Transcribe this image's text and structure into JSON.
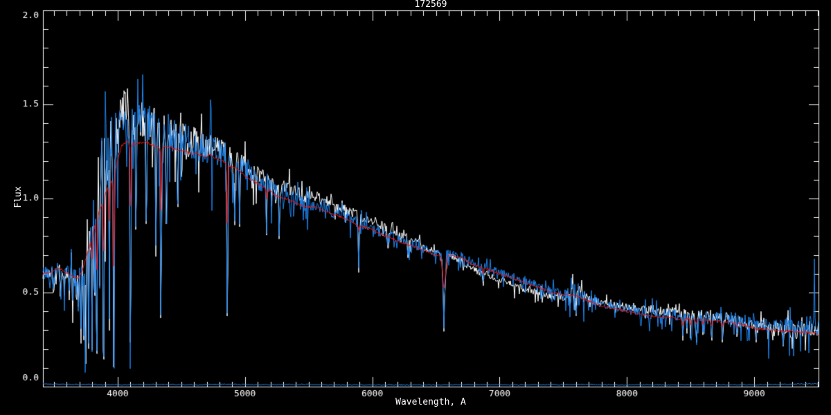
{
  "chart_data": {
    "type": "line",
    "title": "172569",
    "xlabel": "Wavelength, A",
    "ylabel": "Flux",
    "xlim": [
      3413,
      9505
    ],
    "ylim": [
      0,
      2.0
    ],
    "grid": false,
    "legend": null,
    "background_color": "#000000",
    "axis_color": "#ffffff",
    "x_major_ticks": [
      4000,
      5000,
      6000,
      7000,
      8000,
      9000
    ],
    "x_tick_labels": [
      "4000",
      "5000",
      "6000",
      "7000",
      "8000",
      "9000"
    ],
    "x_minor_step": 100,
    "y_major_ticks": [
      0.0,
      0.5,
      1.0,
      1.5,
      2.0
    ],
    "y_tick_labels": [
      "0.0",
      "0.5",
      "1.0",
      "1.5",
      "2.0"
    ],
    "y_minor_step": 0.1,
    "continuum": [
      [
        3413,
        0.6
      ],
      [
        3460,
        0.607
      ],
      [
        3500,
        0.615
      ],
      [
        3525,
        0.635
      ],
      [
        3555,
        0.625
      ],
      [
        3600,
        0.6
      ],
      [
        3650,
        0.585
      ],
      [
        3690,
        0.575
      ],
      [
        3730,
        0.63
      ],
      [
        3770,
        0.73
      ],
      [
        3810,
        0.83
      ],
      [
        3850,
        0.92
      ],
      [
        3890,
        1.0
      ],
      [
        3925,
        1.06
      ],
      [
        3960,
        1.1
      ],
      [
        4000,
        1.2
      ],
      [
        4030,
        1.28
      ],
      [
        4070,
        1.3
      ],
      [
        4120,
        1.29
      ],
      [
        4170,
        1.295
      ],
      [
        4220,
        1.3
      ],
      [
        4270,
        1.285
      ],
      [
        4320,
        1.27
      ],
      [
        4370,
        1.275
      ],
      [
        4420,
        1.27
      ],
      [
        4470,
        1.26
      ],
      [
        4520,
        1.25
      ],
      [
        4570,
        1.24
      ],
      [
        4620,
        1.24
      ],
      [
        4670,
        1.225
      ],
      [
        4720,
        1.23
      ],
      [
        4770,
        1.215
      ],
      [
        4820,
        1.2
      ],
      [
        4880,
        1.17
      ],
      [
        4950,
        1.155
      ],
      [
        5000,
        1.12
      ],
      [
        5060,
        1.095
      ],
      [
        5120,
        1.07
      ],
      [
        5180,
        1.05
      ],
      [
        5250,
        1.01
      ],
      [
        5320,
        1.0
      ],
      [
        5400,
        0.975
      ],
      [
        5480,
        0.955
      ],
      [
        5560,
        0.955
      ],
      [
        5640,
        0.93
      ],
      [
        5720,
        0.91
      ],
      [
        5800,
        0.888
      ],
      [
        5900,
        0.855
      ],
      [
        6000,
        0.835
      ],
      [
        6100,
        0.8
      ],
      [
        6200,
        0.775
      ],
      [
        6300,
        0.75
      ],
      [
        6400,
        0.725
      ],
      [
        6500,
        0.7
      ],
      [
        6600,
        0.7
      ],
      [
        6700,
        0.685
      ],
      [
        6800,
        0.645
      ],
      [
        6900,
        0.625
      ],
      [
        7000,
        0.6
      ],
      [
        7150,
        0.565
      ],
      [
        7300,
        0.53
      ],
      [
        7420,
        0.497
      ],
      [
        7520,
        0.49
      ],
      [
        7620,
        0.478
      ],
      [
        7700,
        0.455
      ],
      [
        7800,
        0.43
      ],
      [
        7900,
        0.415
      ],
      [
        7980,
        0.403
      ],
      [
        8100,
        0.385
      ],
      [
        8200,
        0.375
      ],
      [
        8280,
        0.368
      ],
      [
        8360,
        0.37
      ],
      [
        8420,
        0.36
      ],
      [
        8480,
        0.362
      ],
      [
        8530,
        0.36
      ],
      [
        8580,
        0.358
      ],
      [
        8640,
        0.355
      ],
      [
        8700,
        0.35
      ],
      [
        8780,
        0.345
      ],
      [
        8860,
        0.34
      ],
      [
        8950,
        0.32
      ],
      [
        9050,
        0.307
      ],
      [
        9150,
        0.3
      ],
      [
        9250,
        0.295
      ],
      [
        9350,
        0.292
      ],
      [
        9430,
        0.287
      ],
      [
        9505,
        0.282
      ]
    ],
    "noise_amplitude": [
      [
        3413,
        0.045
      ],
      [
        3600,
        0.05
      ],
      [
        3680,
        0.07
      ],
      [
        3740,
        0.14
      ],
      [
        3800,
        0.2
      ],
      [
        3860,
        0.21
      ],
      [
        3920,
        0.21
      ],
      [
        3970,
        0.18
      ],
      [
        4020,
        0.13
      ],
      [
        4100,
        0.12
      ],
      [
        4200,
        0.115
      ],
      [
        4300,
        0.11
      ],
      [
        4400,
        0.1
      ],
      [
        4550,
        0.09
      ],
      [
        4700,
        0.085
      ],
      [
        4850,
        0.07
      ],
      [
        5000,
        0.055
      ],
      [
        5200,
        0.05
      ],
      [
        5400,
        0.04
      ],
      [
        5600,
        0.035
      ],
      [
        5850,
        0.03
      ],
      [
        6100,
        0.028
      ],
      [
        6350,
        0.025
      ],
      [
        6600,
        0.022
      ],
      [
        6900,
        0.02
      ],
      [
        7200,
        0.02
      ],
      [
        7500,
        0.025
      ],
      [
        7580,
        0.06
      ],
      [
        7615,
        0.1
      ],
      [
        7650,
        0.05
      ],
      [
        7700,
        0.025
      ],
      [
        7900,
        0.025
      ],
      [
        8100,
        0.028
      ],
      [
        8300,
        0.03
      ],
      [
        8500,
        0.028
      ],
      [
        8700,
        0.03
      ],
      [
        8900,
        0.035
      ],
      [
        9100,
        0.04
      ],
      [
        9300,
        0.045
      ],
      [
        9505,
        0.055
      ]
    ],
    "lines": {
      "observed": [
        [
          3497,
          0.52,
          2.5
        ],
        [
          3550,
          0.53,
          2.5
        ],
        [
          3581,
          0.5,
          2.5
        ],
        [
          3620,
          0.51,
          2.5
        ],
        [
          3646,
          0.48,
          3
        ],
        [
          3676,
          0.49,
          2.5
        ],
        [
          3692,
          0.44,
          2.5
        ],
        [
          3712,
          0.33,
          2.5
        ],
        [
          3734,
          0.27,
          2.5
        ],
        [
          3750,
          0.24,
          3
        ],
        [
          3771,
          0.23,
          3
        ],
        [
          3798,
          0.21,
          3.5
        ],
        [
          3819,
          0.5,
          2.5
        ],
        [
          3835,
          0.19,
          3.5
        ],
        [
          3860,
          0.55,
          2.5
        ],
        [
          3889,
          0.16,
          4
        ],
        [
          3934,
          0.36,
          3
        ],
        [
          3970,
          0.12,
          4.5
        ],
        [
          4101,
          0.25,
          4
        ],
        [
          4144,
          0.85,
          2.5
        ],
        [
          4226,
          0.88,
          2.5
        ],
        [
          4300,
          0.75,
          3
        ],
        [
          4340,
          0.38,
          4
        ],
        [
          4383,
          0.88,
          2.5
        ],
        [
          4471,
          0.97,
          2.5
        ],
        [
          4861,
          0.39,
          4
        ],
        [
          4920,
          0.88,
          2.5
        ],
        [
          4957,
          0.9,
          2.5
        ],
        [
          5169,
          0.82,
          3
        ],
        [
          5270,
          0.8,
          3
        ],
        [
          5893,
          0.63,
          3
        ],
        [
          6122,
          0.75,
          2.5
        ],
        [
          6280,
          0.7,
          2.5
        ],
        [
          6563,
          0.45,
          10
        ],
        [
          6563,
          0.31,
          3
        ],
        [
          6870,
          0.56,
          4
        ],
        [
          7180,
          0.52,
          3
        ],
        [
          7600,
          0.42,
          5
        ],
        [
          8227,
          0.42,
          3
        ],
        [
          8440,
          0.27,
          3
        ],
        [
          8470,
          0.31,
          2.5
        ],
        [
          8500,
          0.28,
          3
        ],
        [
          8545,
          0.27,
          3
        ],
        [
          8598,
          0.29,
          3
        ],
        [
          8665,
          0.26,
          3
        ],
        [
          8750,
          0.25,
          3.5
        ],
        [
          8865,
          0.28,
          3.5
        ],
        [
          9015,
          0.25,
          3
        ],
        [
          9110,
          0.3,
          3
        ],
        [
          9229,
          0.23,
          3.5
        ],
        [
          9405,
          0.3,
          3
        ]
      ],
      "model": [
        [
          3798,
          0.68,
          3
        ],
        [
          3835,
          0.62,
          3
        ],
        [
          3889,
          0.72,
          3.5
        ],
        [
          3934,
          0.88,
          2.5
        ],
        [
          3970,
          0.64,
          4
        ],
        [
          4101,
          0.96,
          3.5
        ],
        [
          4340,
          0.94,
          3.5
        ],
        [
          4861,
          0.87,
          3.5
        ],
        [
          5169,
          1.0,
          3
        ],
        [
          5893,
          0.83,
          2.5
        ],
        [
          6563,
          0.53,
          12
        ],
        [
          6870,
          0.6,
          3
        ],
        [
          8440,
          0.325,
          6
        ],
        [
          8500,
          0.33,
          5
        ],
        [
          8545,
          0.335,
          5
        ],
        [
          8598,
          0.33,
          5
        ],
        [
          8665,
          0.325,
          6
        ],
        [
          8750,
          0.32,
          7
        ],
        [
          8860,
          0.315,
          7
        ],
        [
          9015,
          0.3,
          4
        ],
        [
          9229,
          0.29,
          5
        ]
      ]
    },
    "series": [
      {
        "name": "observed-spectrum-white",
        "color": "#ffffff",
        "seed": 1337,
        "lines_key": "observed",
        "line_lift": -0.015,
        "amp_scale": 0.9,
        "downspike_p": 0.05,
        "upspike_p": 0.05,
        "offset": [
          [
            3413,
            0.0
          ],
          [
            3650,
            0.0
          ],
          [
            3720,
            0.03
          ],
          [
            3780,
            0.1
          ],
          [
            3840,
            0.17
          ],
          [
            3900,
            0.22
          ],
          [
            3950,
            0.2
          ],
          [
            4000,
            0.14
          ],
          [
            4040,
            0.18
          ],
          [
            4100,
            0.13
          ],
          [
            4160,
            0.11
          ],
          [
            4240,
            0.11
          ],
          [
            4330,
            0.09
          ],
          [
            4420,
            0.075
          ],
          [
            4520,
            0.07
          ],
          [
            4650,
            0.06
          ],
          [
            4800,
            0.05
          ],
          [
            4950,
            0.05
          ],
          [
            5150,
            0.05
          ],
          [
            5400,
            0.055
          ],
          [
            5700,
            0.055
          ],
          [
            6000,
            0.05
          ],
          [
            6300,
            0.035
          ],
          [
            6550,
            0.0
          ],
          [
            6800,
            -0.027
          ],
          [
            7200,
            -0.032
          ],
          [
            7500,
            -0.012
          ],
          [
            7800,
            0.017
          ],
          [
            8100,
            0.032
          ],
          [
            8400,
            0.035
          ],
          [
            8700,
            0.02
          ],
          [
            9000,
            0.005
          ],
          [
            9300,
            0.005
          ],
          [
            9505,
            0.01
          ]
        ]
      },
      {
        "name": "observed-spectrum-blue",
        "color": "#1e86f0",
        "seed": 42,
        "lines_key": "observed",
        "line_lift": 0,
        "amp_scale": 1.0,
        "downspike_p": 0.1,
        "upspike_p": 0.05,
        "offset": [
          [
            3413,
            0.0
          ],
          [
            3650,
            0.0
          ],
          [
            3720,
            0.03
          ],
          [
            3780,
            0.1
          ],
          [
            3840,
            0.17
          ],
          [
            3900,
            0.22
          ],
          [
            3950,
            0.2
          ],
          [
            4000,
            0.13
          ],
          [
            4040,
            0.17
          ],
          [
            4100,
            0.12
          ],
          [
            4160,
            0.1
          ],
          [
            4240,
            0.1
          ],
          [
            4330,
            0.08
          ],
          [
            4420,
            0.065
          ],
          [
            4520,
            0.06
          ],
          [
            4650,
            0.05
          ],
          [
            4800,
            0.035
          ],
          [
            4950,
            0.025
          ],
          [
            5150,
            0.02
          ],
          [
            5400,
            0.015
          ],
          [
            5700,
            0.012
          ],
          [
            6100,
            0.01
          ],
          [
            6563,
            0.01
          ],
          [
            7000,
            0.008
          ],
          [
            7600,
            0.01
          ],
          [
            8000,
            0.012
          ],
          [
            8400,
            0.015
          ],
          [
            8800,
            0.02
          ],
          [
            9200,
            0.03
          ],
          [
            9505,
            0.04
          ]
        ]
      },
      {
        "name": "model-fit-red",
        "color": "#ee1111",
        "seed": 7,
        "lines_key": "model",
        "line_lift": 0,
        "noise_flat": 0.006
      },
      {
        "name": "error-spectrum-blue",
        "color": "#1e86f0",
        "seed": 99,
        "noise_flat": 0.003,
        "continuum": [
          [
            3413,
            0.018
          ],
          [
            3470,
            0.013
          ],
          [
            3600,
            0.012
          ],
          [
            3800,
            0.011
          ],
          [
            4000,
            0.01
          ],
          [
            4300,
            0.012
          ],
          [
            4600,
            0.01
          ],
          [
            4861,
            0.013
          ],
          [
            5100,
            0.01
          ],
          [
            5460,
            0.012
          ],
          [
            5800,
            0.009
          ],
          [
            6300,
            0.009
          ],
          [
            6870,
            0.011
          ],
          [
            7200,
            0.009
          ],
          [
            7614,
            0.012
          ],
          [
            8000,
            0.009
          ],
          [
            8500,
            0.01
          ],
          [
            9000,
            0.01
          ],
          [
            9300,
            0.013
          ],
          [
            9505,
            0.016
          ]
        ]
      }
    ],
    "spikes": [
      {
        "series": "observed-spectrum-blue",
        "wl": 9473,
        "flux": 0.68
      }
    ]
  }
}
